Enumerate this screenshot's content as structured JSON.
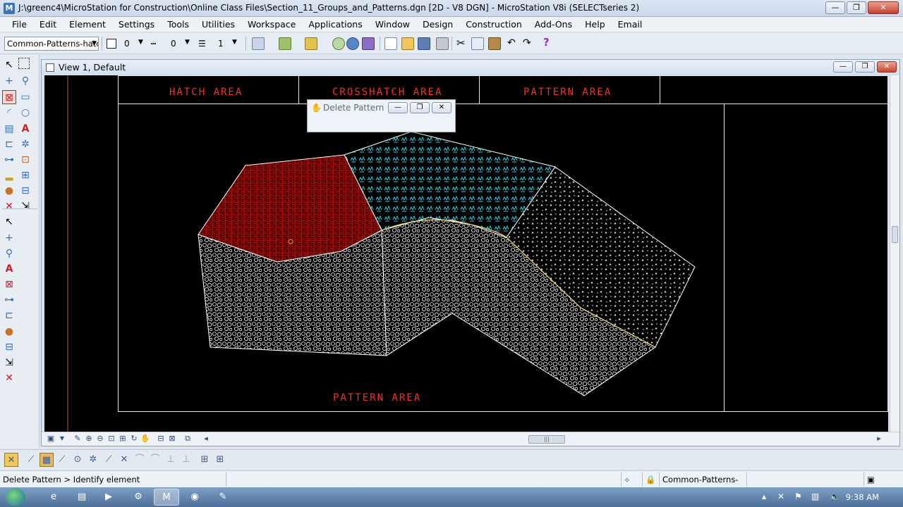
{
  "window": {
    "title": "J:\\greenc4\\MicroStation for Construction\\Online Class Files\\Section_11_Groups_and_Patterns.dgn [2D - V8 DGN] - MicroStation V8i (SELECTseries 2)",
    "minimize": "—",
    "maximize": "❐",
    "close": "✕"
  },
  "menu": [
    "File",
    "Edit",
    "Element",
    "Settings",
    "Tools",
    "Utilities",
    "Workspace",
    "Applications",
    "Window",
    "Design",
    "Construction",
    "Add-Ons",
    "Help",
    "Email"
  ],
  "attributes": {
    "level": "Common-Patterns-hatc",
    "color": "0",
    "style": "0",
    "weight": "1"
  },
  "view": {
    "title": "View 1, Default",
    "labels": {
      "hatch": "HATCH AREA",
      "crosshatch": "CROSSHATCH AREA",
      "pattern_top": "PATTERN AREA",
      "pattern_bottom": "PATTERN AREA"
    }
  },
  "dialog": {
    "title": "Delete Pattern"
  },
  "status": {
    "prompt": "Delete Pattern > Identify element",
    "level": "Common-Patterns-hatc"
  },
  "taskbar": {
    "time": "9:38 AM"
  },
  "colors": {
    "cad_background": "#000000",
    "label_red": "#ff2a2a",
    "hatch_red": "#cc1111",
    "crosshatch_cyan": "#22d3e6",
    "pattern_white": "#ffffff"
  }
}
